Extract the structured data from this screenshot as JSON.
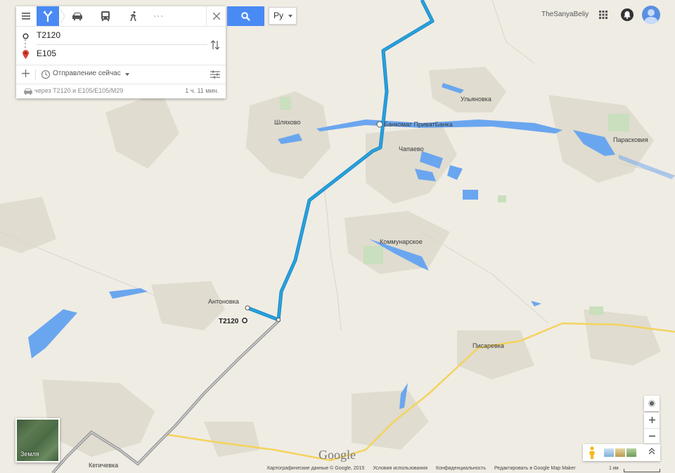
{
  "directions": {
    "waypoints": [
      {
        "text": "T2120"
      },
      {
        "text": "E105"
      }
    ],
    "departure": "Отправление сейчас",
    "route_via": "через T2120 и E105/E105/M29",
    "route_time": "1 ч. 11 мин."
  },
  "search": {
    "icon": "search-icon"
  },
  "language": {
    "selected": "Ру"
  },
  "account": {
    "username": "TheSanyaBeliy"
  },
  "map": {
    "labels": {
      "ulyanovka": "Ульяновка",
      "shlyakhovoe": "Шляхово",
      "bankomat": "Банкомат ПриватБанка",
      "chapaevo": "Чапаево",
      "paraskoviya": "Парасковия",
      "kommunarskoe": "Коммунарское",
      "antonovka": "Антоновка",
      "t2120": "T2120",
      "pisarevka": "Писаревка",
      "kegichevka": "Кегичевка"
    },
    "route_color": "#27a3dd",
    "yellow_road_color": "#f4d35e",
    "water_color": "#6aa6ef"
  },
  "earth": {
    "label": "Земля"
  },
  "google": "Google",
  "footer": {
    "mapdata": "Картографические данные © Google, 2015",
    "terms": "Условия использования",
    "privacy": "Конфиденциальность",
    "mapmaker": "Редактировать в Google Map Maker",
    "scale": "1 км"
  }
}
